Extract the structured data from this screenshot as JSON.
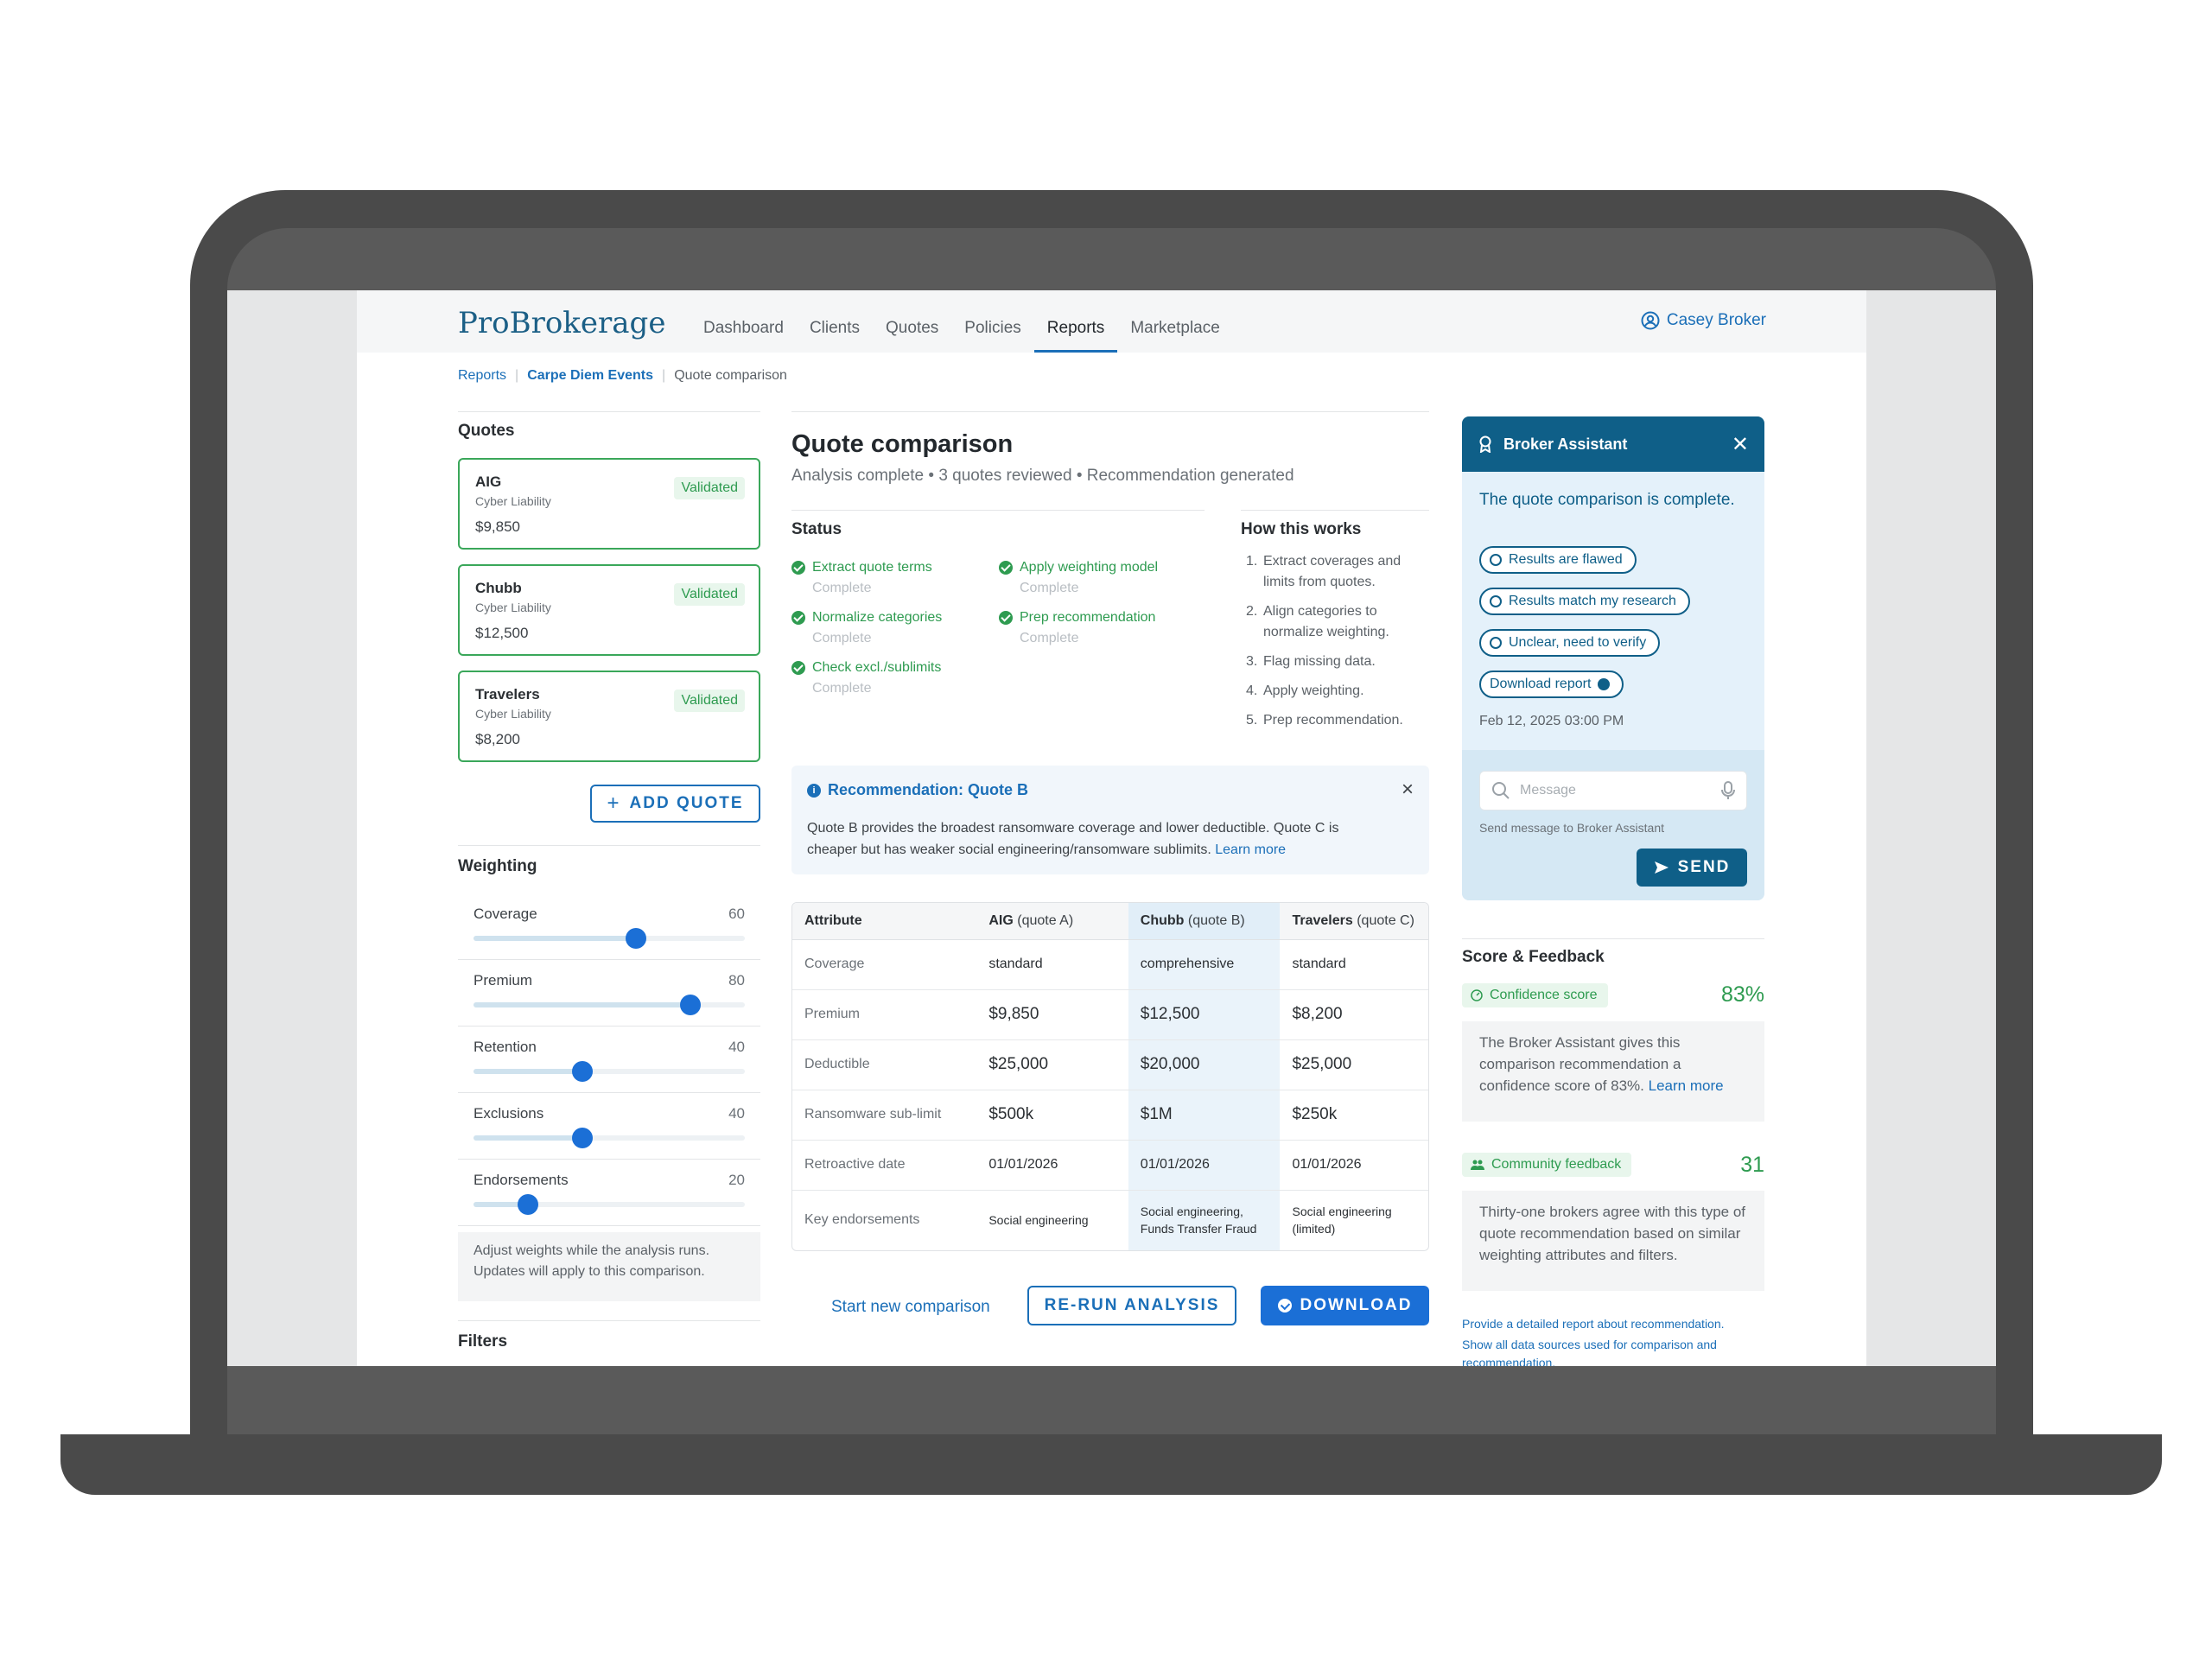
{
  "app": {
    "logo": "ProBrokerage",
    "user": "Casey Broker"
  },
  "nav": [
    "Dashboard",
    "Clients",
    "Quotes",
    "Policies",
    "Reports",
    "Marketplace"
  ],
  "nav_active": "Reports",
  "breadcrumb": {
    "root": "Reports",
    "client": "Carpe Diem Events",
    "current": "Quote comparison"
  },
  "quotes": {
    "title": "Quotes",
    "items": [
      {
        "name": "AIG",
        "type": "Cyber Liability",
        "price": "$9,850",
        "status": "Validated"
      },
      {
        "name": "Chubb",
        "type": "Cyber Liability",
        "price": "$12,500",
        "status": "Validated"
      },
      {
        "name": "Travelers",
        "type": "Cyber Liability",
        "price": "$8,200",
        "status": "Validated"
      }
    ],
    "add_label": "ADD QUOTE"
  },
  "weighting": {
    "title": "Weighting",
    "max": 100,
    "sliders": [
      {
        "label": "Coverage",
        "value": 60
      },
      {
        "label": "Premium",
        "value": 80
      },
      {
        "label": "Retention",
        "value": 40
      },
      {
        "label": "Exclusions",
        "value": 40
      },
      {
        "label": "Endorsements",
        "value": 20
      }
    ],
    "note": "Adjust weights while the analysis runs. Updates will apply to this comparison."
  },
  "filters_title": "Filters",
  "main": {
    "title": "Quote comparison",
    "subtitle": "Analysis complete • 3 quotes reviewed • Recommendation generated",
    "status_title": "Status",
    "status_items": [
      {
        "label": "Extract quote terms",
        "state": "Complete"
      },
      {
        "label": "Apply weighting model",
        "state": "Complete"
      },
      {
        "label": "Normalize categories",
        "state": "Complete"
      },
      {
        "label": "Prep recommendation",
        "state": "Complete"
      },
      {
        "label": "Check excl./sublimits",
        "state": "Complete"
      }
    ],
    "how_title": "How this works",
    "how_items": [
      "Extract coverages and limits from quotes.",
      "Align categories to normalize weighting.",
      "Flag missing data.",
      "Apply weighting.",
      "Prep recommendation."
    ],
    "recommendation": {
      "title": "Recommendation: Quote B",
      "text": "Quote B provides the broadest ransomware coverage and lower deductible. Quote C is cheaper but has weaker social engineering/ransomware sublimits.",
      "link": "Learn more"
    },
    "table": {
      "headers": [
        {
          "name": "Attribute",
          "q": ""
        },
        {
          "name": "AIG",
          "q": "(quote A)"
        },
        {
          "name": "Chubb",
          "q": "(quote B)"
        },
        {
          "name": "Travelers",
          "q": "(quote C)"
        }
      ],
      "rows": [
        [
          "Coverage",
          "standard",
          "comprehensive",
          "standard"
        ],
        [
          "Premium",
          "$9,850",
          "$12,500",
          "$8,200"
        ],
        [
          "Deductible",
          "$25,000",
          "$20,000",
          "$25,000"
        ],
        [
          "Ransomware sub-limit",
          "$500k",
          "$1M",
          "$250k"
        ],
        [
          "Retroactive date",
          "01/01/2026",
          "01/01/2026",
          "01/01/2026"
        ],
        [
          "Key endorsements",
          "Social engineering",
          "Social engineering, Funds Transfer Fraud",
          "Social engineering (limited)"
        ]
      ]
    },
    "actions": {
      "new": "Start new comparison",
      "rerun": "RE-RUN ANALYSIS",
      "download": "DOWNLOAD"
    }
  },
  "assistant": {
    "title": "Broker Assistant",
    "message": "The quote comparison is complete.",
    "chips": [
      "Results are flawed",
      "Results match my research",
      "Unclear, need to verify"
    ],
    "download_chip": "Download report",
    "timestamp": "Feb 12, 2025  03:00 PM",
    "input_placeholder": "Message",
    "input_hint": "Send message to Broker Assistant",
    "send": "SEND"
  },
  "score": {
    "title": "Score & Feedback",
    "confidence_label": "Confidence score",
    "confidence_value": "83%",
    "confidence_text": "The Broker Assistant gives this comparison recommendation a confidence score of 83%.",
    "confidence_link": "Learn more",
    "community_label": "Community feedback",
    "community_value": "31",
    "community_text": "Thirty-one brokers agree with this type of quote recommendation based on similar weighting attributes and filters.",
    "link1": "Provide a detailed report about recommendation.",
    "link2": "Show all data sources used for  comparison and recommendation."
  },
  "colors": {
    "brand": "#1b5f86",
    "accent": "#1b6fd6",
    "success": "#2e9b50",
    "assistant": "#0f5f88"
  }
}
